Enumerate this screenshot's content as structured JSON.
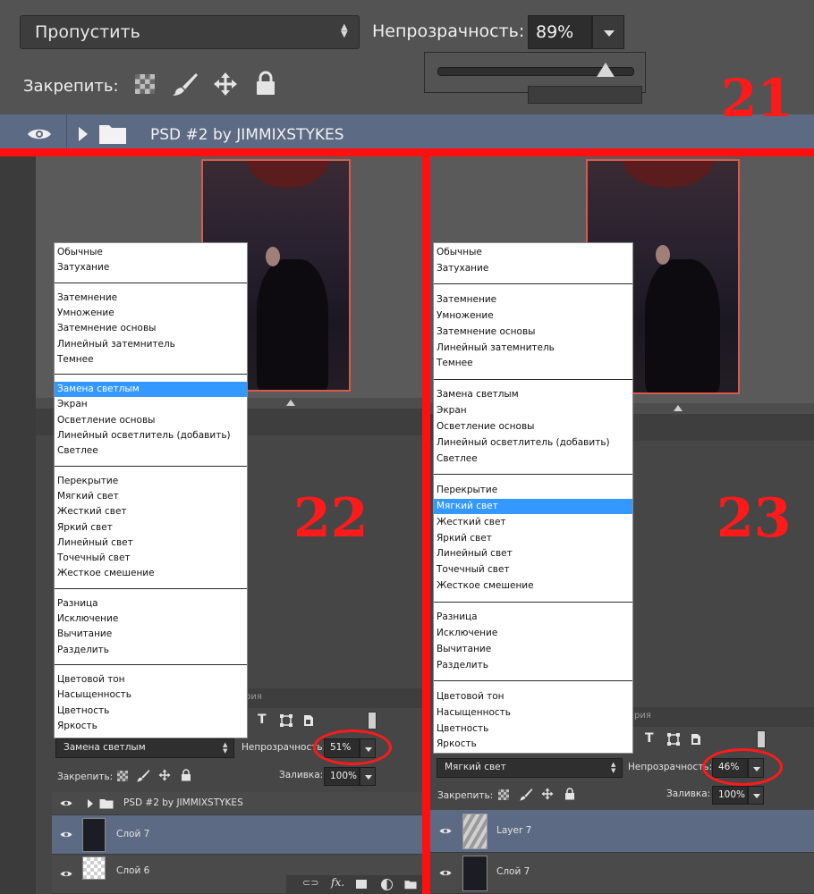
{
  "top": {
    "blend_mode": "Пропустить",
    "opacity_label": "Непрозрачность:",
    "opacity_value": "89%",
    "opacity_slider_fraction": 0.89,
    "lock_label": "Закрепить:",
    "group_name": "PSD #2 by JIMMIXSTYKES",
    "step_number": "21"
  },
  "panel22": {
    "step_number": "22",
    "menu_items": [
      "Обычные",
      "Затухание",
      "Затемнение",
      "Умножение",
      "Затемнение основы",
      "Линейный затемнитель",
      "Темнее",
      "Замена светлым",
      "Экран",
      "Осветление основы",
      "Линейный осветлитель (добавить)",
      "Светлее",
      "Перекрытие",
      "Мягкий свет",
      "Жесткий свет",
      "Яркий свет",
      "Линейный свет",
      "Точечный свет",
      "Жесткое смешение",
      "Разница",
      "Исключение",
      "Вычитание",
      "Разделить",
      "Цветовой тон",
      "Насыщенность",
      "Цветность",
      "Яркость"
    ],
    "selected_item": "Замена светлым",
    "blend_mode": "Замена светлым",
    "opacity_label": "Непрозрачность:",
    "opacity_value": "51%",
    "lock_label": "Закрепить:",
    "fill_label": "Заливка:",
    "fill_value": "100%",
    "group_name": "PSD #2 by JIMMIXSTYKES",
    "layers": [
      "Слой 7",
      "Слой 6"
    ],
    "tab_fragment": "рия"
  },
  "panel23": {
    "step_number": "23",
    "menu_items": [
      "Обычные",
      "Затухание",
      "Затемнение",
      "Умножение",
      "Затемнение основы",
      "Линейный затемнитель",
      "Темнее",
      "Замена светлым",
      "Экран",
      "Осветление основы",
      "Линейный осветлитель (добавить)",
      "Светлее",
      "Перекрытие",
      "Мягкий свет",
      "Жесткий свет",
      "Яркий свет",
      "Линейный свет",
      "Точечный свет",
      "Жесткое смешение",
      "Разница",
      "Исключение",
      "Вычитание",
      "Разделить",
      "Цветовой тон",
      "Насыщенность",
      "Цветность",
      "Яркость"
    ],
    "selected_item": "Мягкий свет",
    "blend_mode": "Мягкий свет",
    "opacity_label": "Непрозрачность:",
    "opacity_value": "46%",
    "lock_label": "Закрепить:",
    "fill_label": "Заливка:",
    "fill_value": "100%",
    "layers": [
      "Layer 7",
      "Слой 7"
    ],
    "tab_fragment": "рия"
  },
  "icons": {
    "bottom_bar": [
      "link-icon",
      "fx-icon",
      "mask-icon",
      "adjustment-icon",
      "folder-icon"
    ],
    "filter_bar": [
      "text-type-icon",
      "shape-icon",
      "smart-object-icon",
      "toggle-icon"
    ]
  },
  "colors": {
    "annotation_red": "#ff1a1a",
    "selected_layer": "#5d6a83",
    "menu_highlight": "#3398ff"
  }
}
